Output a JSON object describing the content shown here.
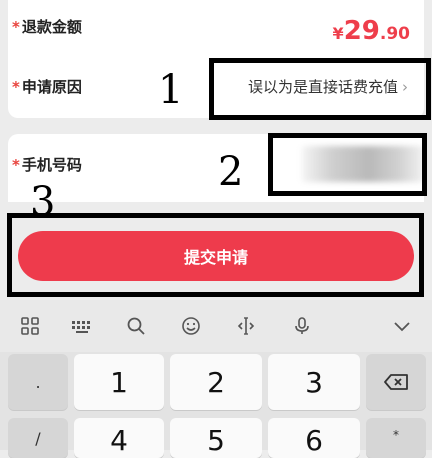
{
  "refund": {
    "star": "*",
    "label": "退款金额",
    "currency": "¥",
    "amount_int": "29",
    "amount_dec": ".90"
  },
  "reason": {
    "star": "*",
    "label": "申请原因",
    "value": "误以为是直接话费充值",
    "chevron": "›"
  },
  "phone": {
    "star": "*",
    "label": "手机号码"
  },
  "submit": {
    "label": "提交申请"
  },
  "annotations": {
    "n1": "1",
    "n2": "2",
    "n3": "3"
  },
  "keyboard": {
    "toolbar_icons": [
      "grid-icon",
      "keyboard-icon",
      "search-icon",
      "emoji-icon",
      "cursor-icon",
      "microphone-icon",
      "chevron-down-icon"
    ],
    "keys": {
      "dot": ".",
      "slash": "/",
      "k1": "1",
      "k2": "2",
      "k3": "3",
      "k4": "4",
      "k5": "5",
      "k6": "6",
      "star": "*"
    },
    "backspace_icon": "backspace-icon"
  },
  "colors": {
    "accent": "#ee3b4c",
    "annotation": "#000000"
  }
}
